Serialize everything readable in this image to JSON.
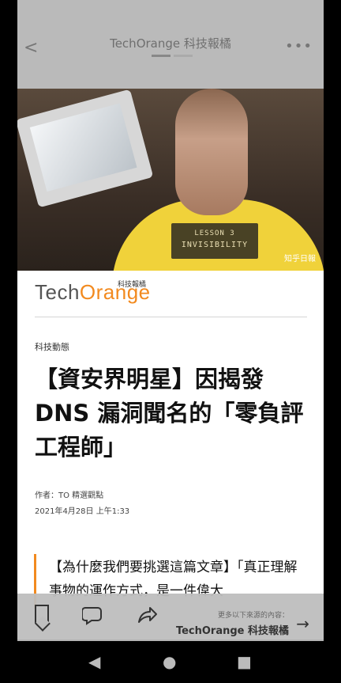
{
  "header": {
    "back_icon": "back-chevron-icon",
    "title": "TechOrange 科技報橘",
    "more_icon": "more-dots-icon"
  },
  "hero": {
    "shirt_line1": "LESSON 3",
    "shirt_line2": "INVISIBILITY",
    "watermark": "知乎日報"
  },
  "logo": {
    "tech": "Tech",
    "orange": "Orange",
    "small": "科技報橘"
  },
  "article": {
    "category": "科技動態",
    "headline": "【資安界明星】因揭發 DNS 漏洞聞名的「零負評工程師」",
    "author": "作者：TO 精選觀點",
    "date": "2021年4月28日 上午1:33",
    "quote": "【為什麼我們要挑選這篇文章】「真正理解事物的運作方式，是一件偉大"
  },
  "toolbar": {
    "bookmark_icon": "bookmark-icon",
    "comment_icon": "comment-icon",
    "share_icon": "share-icon",
    "more_label": "更多以下來源的內容：",
    "more_source": "TechOrange 科技報橘",
    "arrow_icon": "arrow-right-icon"
  },
  "nav": {
    "back": "◀",
    "home": "●",
    "recents": "■"
  }
}
